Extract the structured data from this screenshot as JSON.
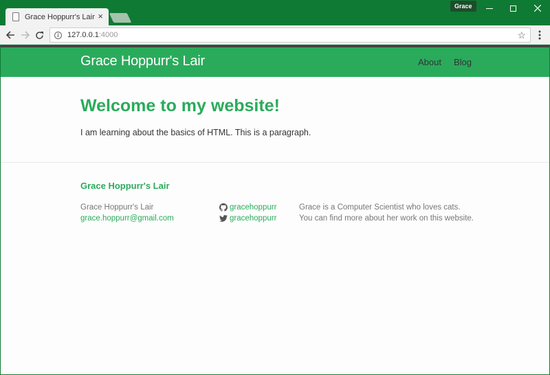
{
  "browser": {
    "tab_title": "Grace Hoppurr's Lair",
    "tab_close": "×",
    "profile_name": "Grace",
    "url": "127.0.0.1:4000",
    "url_host": "127.0.0.1",
    "url_port": ":4000"
  },
  "site": {
    "title": "Grace Hoppurr's Lair",
    "nav": [
      {
        "label": "About"
      },
      {
        "label": "Blog"
      }
    ]
  },
  "main": {
    "heading": "Welcome to my website!",
    "paragraph": "I am learning about the basics of HTML. This is a paragraph."
  },
  "footer": {
    "heading": "Grace Hoppurr's Lair",
    "name": "Grace Hoppurr's Lair",
    "email": "grace.hoppurr@gmail.com",
    "github_user": "gracehoppurr",
    "twitter_user": "gracehoppurr",
    "description_line1": "Grace is a Computer Scientist who loves cats.",
    "description_line2": "You can find more about her work on this website."
  },
  "colors": {
    "accent": "#2aab5b",
    "chrome": "#0f7a33"
  }
}
